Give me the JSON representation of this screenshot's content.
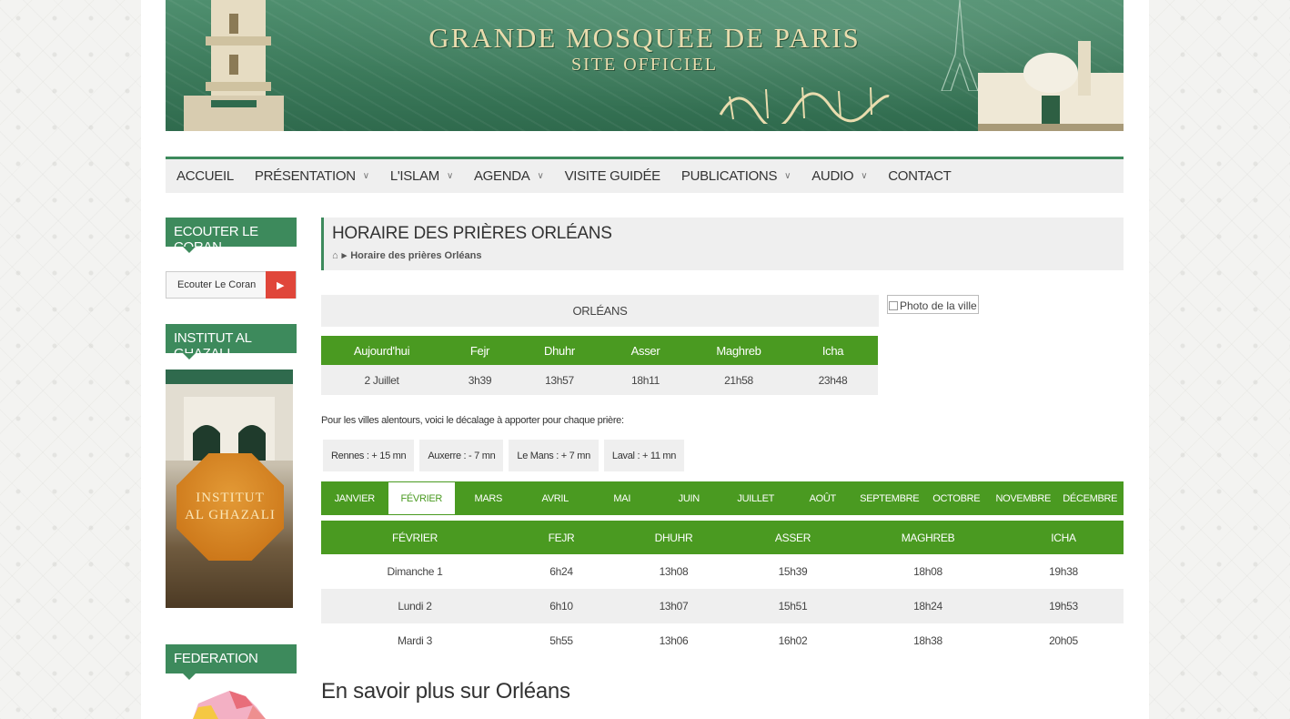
{
  "banner": {
    "title": "GRANDE MOSQUEE DE PARIS",
    "subtitle": "SITE OFFICIEL"
  },
  "nav": [
    {
      "label": "ACCUEIL",
      "has_menu": false
    },
    {
      "label": "PRÉSENTATION",
      "has_menu": true
    },
    {
      "label": "L'ISLAM",
      "has_menu": true
    },
    {
      "label": "AGENDA",
      "has_menu": true
    },
    {
      "label": "VISITE GUIDÉE",
      "has_menu": false
    },
    {
      "label": "PUBLICATIONS",
      "has_menu": true
    },
    {
      "label": "AUDIO",
      "has_menu": true
    },
    {
      "label": "CONTACT",
      "has_menu": false
    }
  ],
  "sidebar": {
    "coran_heading": "ECOUTER LE CORAN",
    "coran_button": "Ecouter Le Coran",
    "institut_heading": "INSTITUT AL GHAZALI",
    "institut_logo_line1": "INSTITUT",
    "institut_logo_line2": "AL GHAZALI",
    "federation_heading": "FEDERATION"
  },
  "page": {
    "title": "HORAIRE DES PRIÈRES ORLÉANS",
    "breadcrumb": "Horaire des prières Orléans",
    "city": "ORLÉANS",
    "photo_alt": "Photo de la ville"
  },
  "today": {
    "headers": [
      "Aujourd'hui",
      "Fejr",
      "Dhuhr",
      "Asser",
      "Maghreb",
      "Icha"
    ],
    "row": [
      "2 Juillet",
      "3h39",
      "13h57",
      "18h11",
      "21h58",
      "23h48"
    ]
  },
  "nearby": {
    "note": "Pour les villes alentours, voici le décalage à apporter pour chaque prière:",
    "cities": [
      "Rennes : + 15 mn",
      "Auxerre : - 7 mn",
      "Le Mans : + 7 mn",
      "Laval : + 11 mn"
    ]
  },
  "months": [
    "JANVIER",
    "FÉVRIER",
    "MARS",
    "AVRIL",
    "MAI",
    "JUIN",
    "JUILLET",
    "AOÛT",
    "SEPTEMBRE",
    "OCTOBRE",
    "NOVEMBRE",
    "DÉCEMBRE"
  ],
  "active_month": "FÉVRIER",
  "monthly": {
    "headers": [
      "FÉVRIER",
      "FEJR",
      "DHUHR",
      "ASSER",
      "MAGHREB",
      "ICHA"
    ],
    "rows": [
      [
        "Dimanche 1",
        "6h24",
        "13h08",
        "15h39",
        "18h08",
        "19h38"
      ],
      [
        "Lundi 2",
        "6h10",
        "13h07",
        "15h51",
        "18h24",
        "19h53"
      ],
      [
        "Mardi 3",
        "5h55",
        "13h06",
        "16h02",
        "18h38",
        "20h05"
      ]
    ]
  },
  "more": {
    "title": "En savoir plus sur Orléans"
  },
  "colors": {
    "brand_green": "#3d8a5c",
    "table_green": "#4a9a21",
    "play_red": "#e0463a"
  }
}
